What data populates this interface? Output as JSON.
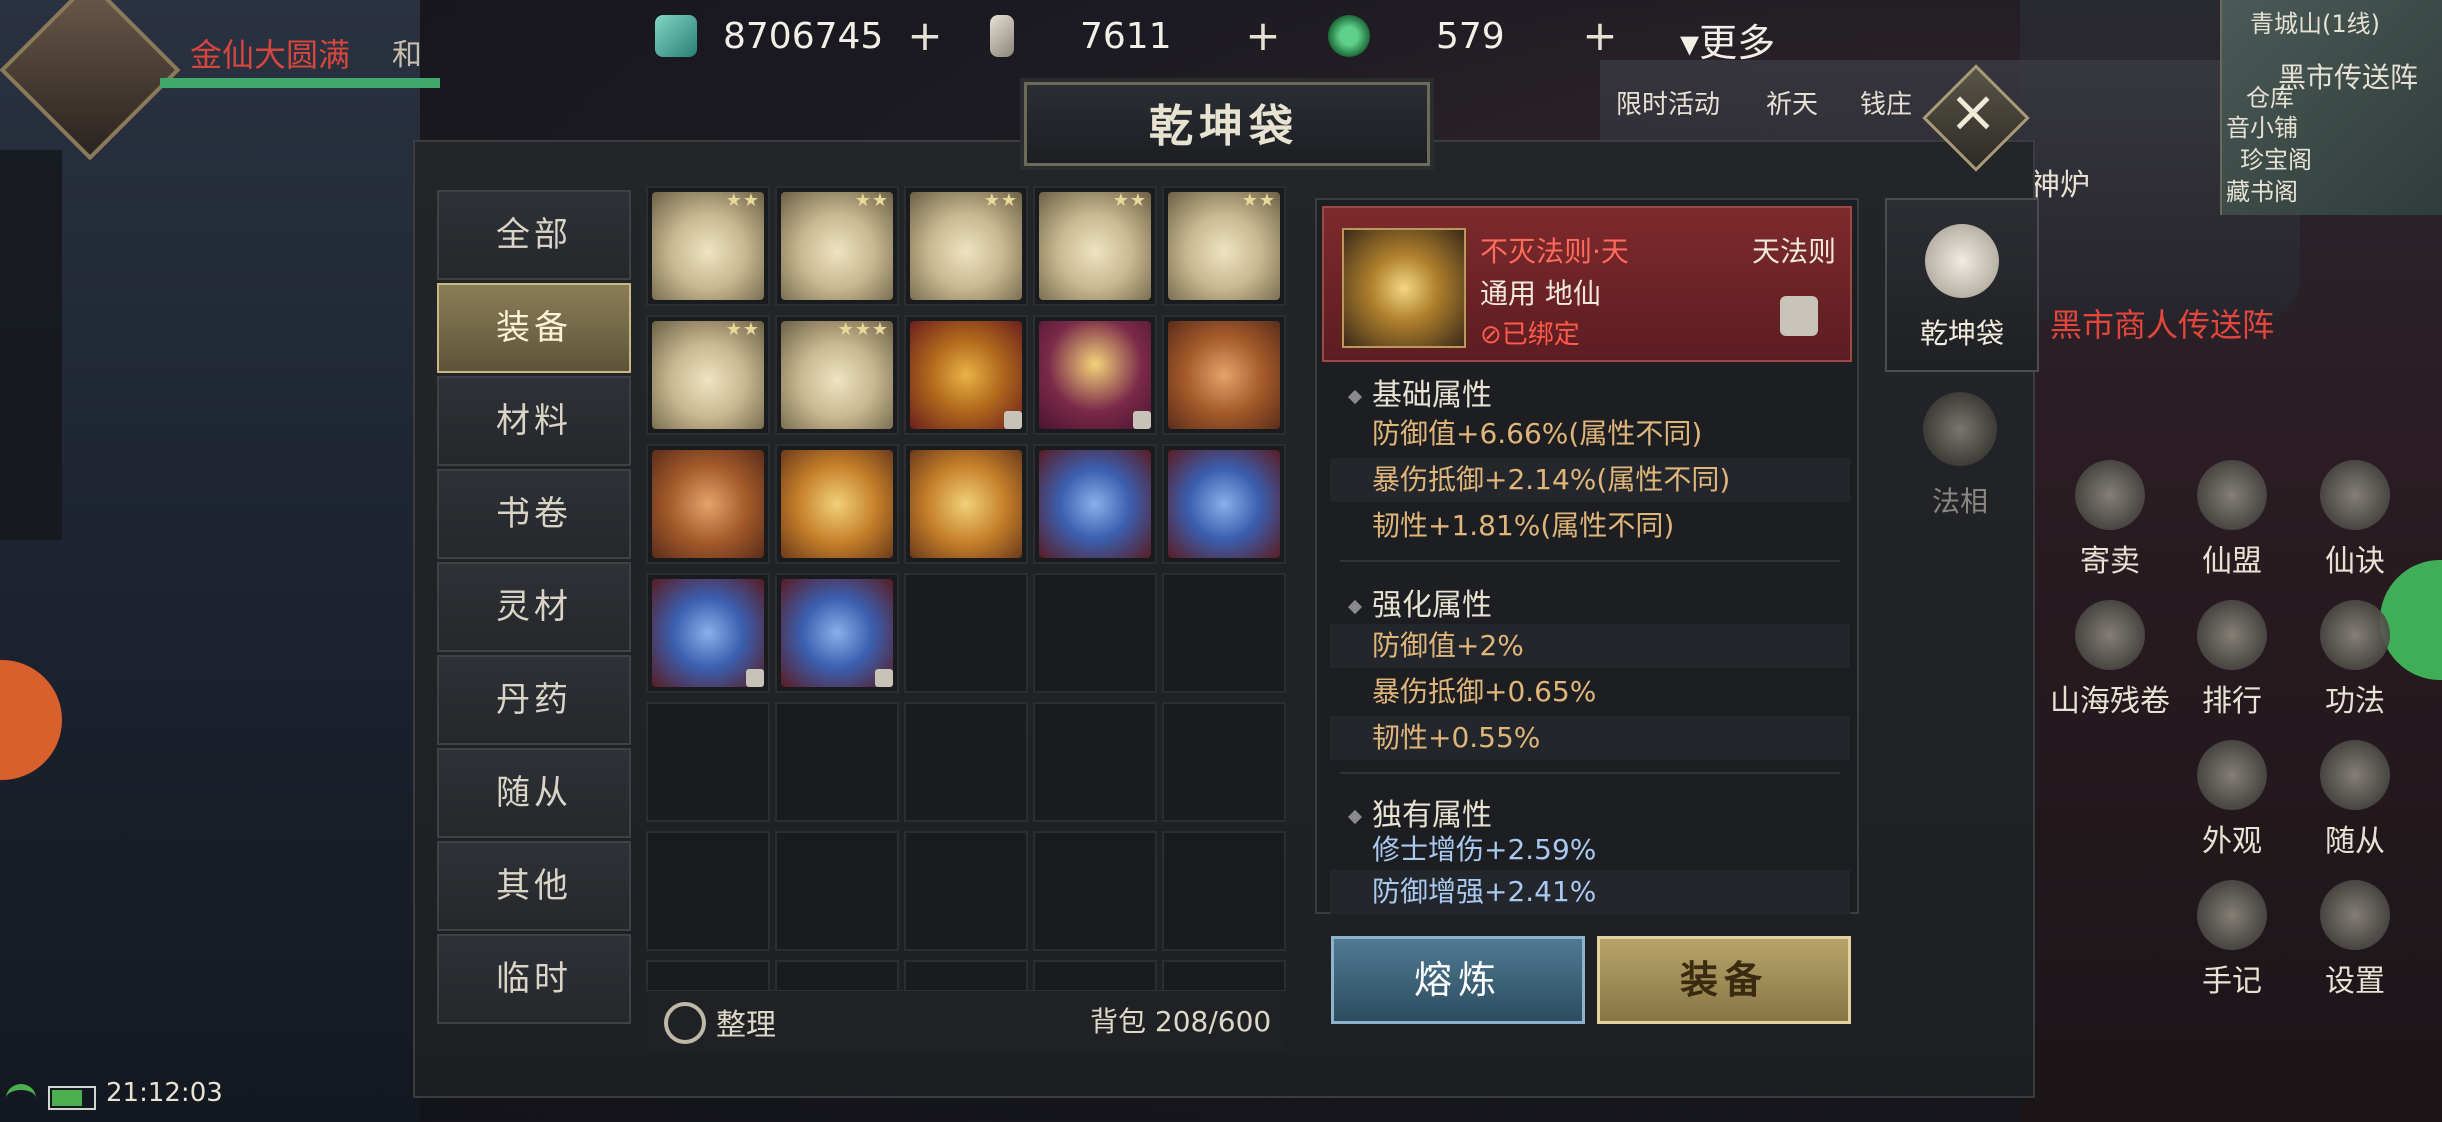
{
  "hud": {
    "player_name": "金仙大圆满",
    "player_status": "和",
    "currencies": [
      {
        "icon": "jade-crystal-icon",
        "value": "8706745"
      },
      {
        "icon": "talisman-icon",
        "value": "7611"
      },
      {
        "icon": "jade-ring-icon",
        "value": "579"
      }
    ],
    "more_label": "更多",
    "time": "21:12:03"
  },
  "world": {
    "minimap_title": "青城山(1线)",
    "map_labels": [
      "黑市传送阵",
      "仓库",
      "音小铺",
      "珍宝阁",
      "藏书阁"
    ],
    "teleport_label": "黑市商人传送阵",
    "top_menu": [
      "限时活动",
      "祈天",
      "钱庄"
    ],
    "side_menu": [
      {
        "label": "神炉",
        "icon": "furnace-icon"
      },
      {
        "label": "寄卖",
        "icon": "consign-icon"
      },
      {
        "label": "仙盟",
        "icon": "alliance-icon"
      },
      {
        "label": "仙诀",
        "icon": "scroll-icon"
      },
      {
        "label": "山海残卷",
        "icon": "map-scroll-icon"
      },
      {
        "label": "排行",
        "icon": "ranking-icon"
      },
      {
        "label": "功法",
        "icon": "technique-icon"
      },
      {
        "label": "外观",
        "icon": "appearance-icon"
      },
      {
        "label": "随从",
        "icon": "follower-icon"
      },
      {
        "label": "手记",
        "icon": "notebook-icon"
      },
      {
        "label": "设置",
        "icon": "gear-icon"
      }
    ]
  },
  "panel": {
    "title": "乾坤袋",
    "categories": [
      "全部",
      "装备",
      "材料",
      "书卷",
      "灵材",
      "丹药",
      "随从",
      "其他",
      "临时"
    ],
    "active_category": "装备",
    "sort_label": "整理",
    "bag_label": "背包",
    "bag_count": "208/600",
    "tabs": [
      {
        "label": "乾坤袋",
        "icon": "pouch-icon"
      },
      {
        "label": "法相",
        "icon": "dharma-form-icon"
      }
    ]
  },
  "items": [
    {
      "type": "scroll",
      "stars": "★★"
    },
    {
      "type": "scroll",
      "stars": "★★"
    },
    {
      "type": "scroll",
      "stars": "★★"
    },
    {
      "type": "scroll",
      "stars": "★★"
    },
    {
      "type": "scroll",
      "stars": "★★"
    },
    {
      "type": "scroll",
      "stars": "★★"
    },
    {
      "type": "scroll",
      "stars": "★★★"
    },
    {
      "type": "lion",
      "stars": "",
      "locked": true
    },
    {
      "type": "moon",
      "stars": "",
      "locked": true
    },
    {
      "type": "token",
      "stars": ""
    },
    {
      "type": "token",
      "stars": ""
    },
    {
      "type": "ding",
      "stars": ""
    },
    {
      "type": "ding",
      "stars": ""
    },
    {
      "type": "orb",
      "stars": ""
    },
    {
      "type": "orb",
      "stars": ""
    },
    {
      "type": "orb",
      "stars": "",
      "locked": true
    },
    {
      "type": "orb",
      "stars": "",
      "locked": true
    }
  ],
  "detail": {
    "name": "不灭法则·天",
    "type": "天法则",
    "sub": "通用 地仙",
    "bound": "已绑定",
    "sections": [
      {
        "title": "基础属性",
        "attrs": [
          "防御值+6.66%(属性不同)",
          "暴伤抵御+2.14%(属性不同)",
          "韧性+1.81%(属性不同)"
        ]
      },
      {
        "title": "强化属性",
        "attrs": [
          "防御值+2%",
          "暴伤抵御+0.65%",
          "韧性+0.55%"
        ]
      },
      {
        "title": "独有属性",
        "attrs": [
          "修士增伤+2.59%",
          "防御增强+2.41%"
        ]
      }
    ],
    "smelt_label": "熔炼",
    "equip_label": "装备"
  }
}
